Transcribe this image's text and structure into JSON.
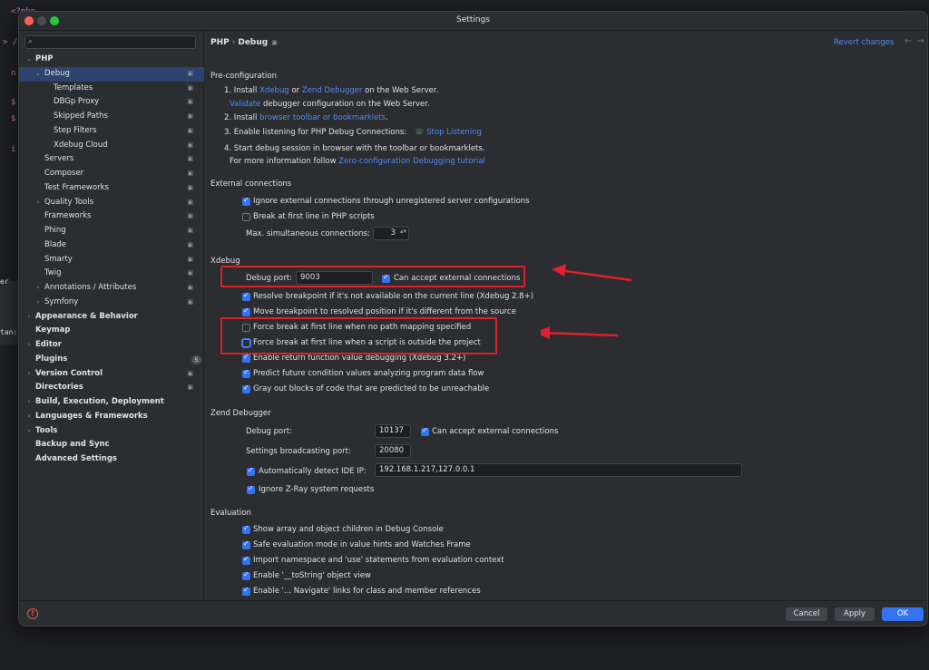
{
  "editor_bg": {
    "fragments": [
      "<?php",
      "> /",
      "n",
      "$",
      "$",
      "i",
      "er",
      "tan:"
    ]
  },
  "window": {
    "title": "Settings"
  },
  "sidebar": {
    "search_placeholder": "",
    "items": [
      {
        "label": "PHP",
        "arrow": "⌄",
        "bold": true
      },
      {
        "label": "Debug",
        "arrow": "⌄",
        "selected": true,
        "proj": "▣"
      },
      {
        "label": "Templates",
        "proj": "▣"
      },
      {
        "label": "DBGp Proxy",
        "proj": "▣"
      },
      {
        "label": "Skipped Paths",
        "proj": "▣"
      },
      {
        "label": "Step Filters",
        "proj": "▣"
      },
      {
        "label": "Xdebug Cloud",
        "proj": "▣"
      },
      {
        "label": "Servers",
        "proj": "▣"
      },
      {
        "label": "Composer",
        "proj": "▣"
      },
      {
        "label": "Test Frameworks",
        "proj": "▣"
      },
      {
        "label": "Quality Tools",
        "arrow": "›",
        "proj": "▣"
      },
      {
        "label": "Frameworks",
        "proj": "▣"
      },
      {
        "label": "Phing",
        "proj": "▣"
      },
      {
        "label": "Blade",
        "proj": "▣"
      },
      {
        "label": "Smarty",
        "proj": "▣"
      },
      {
        "label": "Twig",
        "proj": "▣"
      },
      {
        "label": "Annotations / Attributes",
        "arrow": "›",
        "proj": "▣"
      },
      {
        "label": "Symfony",
        "arrow": "›",
        "proj": "▣"
      },
      {
        "label": "Appearance & Behavior",
        "arrow": "›",
        "bold": true
      },
      {
        "label": "Keymap",
        "bold": true
      },
      {
        "label": "Editor",
        "arrow": "›",
        "bold": true
      },
      {
        "label": "Plugins",
        "bold": true,
        "badge": "5"
      },
      {
        "label": "Version Control",
        "arrow": "›",
        "bold": true,
        "proj": "▣"
      },
      {
        "label": "Directories",
        "bold": true,
        "proj": "▣"
      },
      {
        "label": "Build, Execution, Deployment",
        "arrow": "›",
        "bold": true
      },
      {
        "label": "Languages & Frameworks",
        "arrow": "›",
        "bold": true
      },
      {
        "label": "Tools",
        "arrow": "›",
        "bold": true
      },
      {
        "label": "Backup and Sync",
        "bold": true
      },
      {
        "label": "Advanced Settings",
        "bold": true
      }
    ]
  },
  "header": {
    "crumb1": "PHP",
    "crumb_sep": "›",
    "crumb2": "Debug",
    "proj": "▣",
    "revert": "Revert changes",
    "nav": "←→"
  },
  "preconfig": {
    "title": "Pre-configuration",
    "step1_a": "1. Install ",
    "step1_xdebug": "Xdebug",
    "step1_or": " or ",
    "step1_zend": "Zend Debugger",
    "step1_b": " on the Web Server.",
    "validate": "Validate",
    "validate_rest": " debugger configuration on the Web Server.",
    "step2_a": "2. Install ",
    "step2_link": "browser toolbar or bookmarklets",
    "step2_b": ".",
    "step3": "3. Enable listening for PHP Debug Connections:",
    "stop_icon": "☏",
    "stop": "Stop Listening",
    "step4": "4. Start debug session in browser with the toolbar or bookmarklets.",
    "more_a": "For more information follow ",
    "more_link": "Zero-configuration Debugging tutorial"
  },
  "external": {
    "title": "External connections",
    "ignore": "Ignore external connections through unregistered server configurations",
    "break_first": "Break at first line in PHP scripts",
    "max_label": "Max. simultaneous connections:",
    "max_value": "3",
    "spin": "▴▾"
  },
  "xdebug": {
    "title": "Xdebug",
    "port_label": "Debug port:",
    "port_value": "9003",
    "accept": "Can accept external connections",
    "resolve": "Resolve breakpoint if it's not available on the current line (Xdebug 2.8+)",
    "move": "Move breakpoint to resolved position if it's different from the source",
    "force_no_path": "Force break at first line when no path mapping specified",
    "force_outside": "Force break at first line when a script is outside the project",
    "return_value": "Enable return function value debugging (Xdebug 3.2+)",
    "predict": "Predict future condition values analyzing program data flow",
    "gray_out": "Gray out blocks of code that are predicted to be unreachable"
  },
  "zend": {
    "title": "Zend Debugger",
    "port_label": "Debug port:",
    "port_value": "10137",
    "accept": "Can accept external connections",
    "broadcast_label": "Settings broadcasting port:",
    "broadcast_value": "20080",
    "auto_detect": "Automatically detect IDE IP:",
    "ip_value": "192.168.1.217,127.0.0.1",
    "ignore_zray": "Ignore Z-Ray system requests"
  },
  "evaluation": {
    "title": "Evaluation",
    "show_array": "Show array and object children in Debug Console",
    "safe_eval": "Safe evaluation mode in value hints and Watches Frame",
    "import_ns": "Import namespace and 'use' statements from evaluation context",
    "tostring": "Enable '__toString' object view",
    "navigate": "Enable '... Navigate' links for class and member references"
  },
  "footer": {
    "help_icon": "!",
    "cancel": "Cancel",
    "apply": "Apply",
    "ok": "OK"
  },
  "colors": {
    "accent": "#3574f0",
    "link": "#548af7",
    "annotation_red": "#e0202a"
  }
}
